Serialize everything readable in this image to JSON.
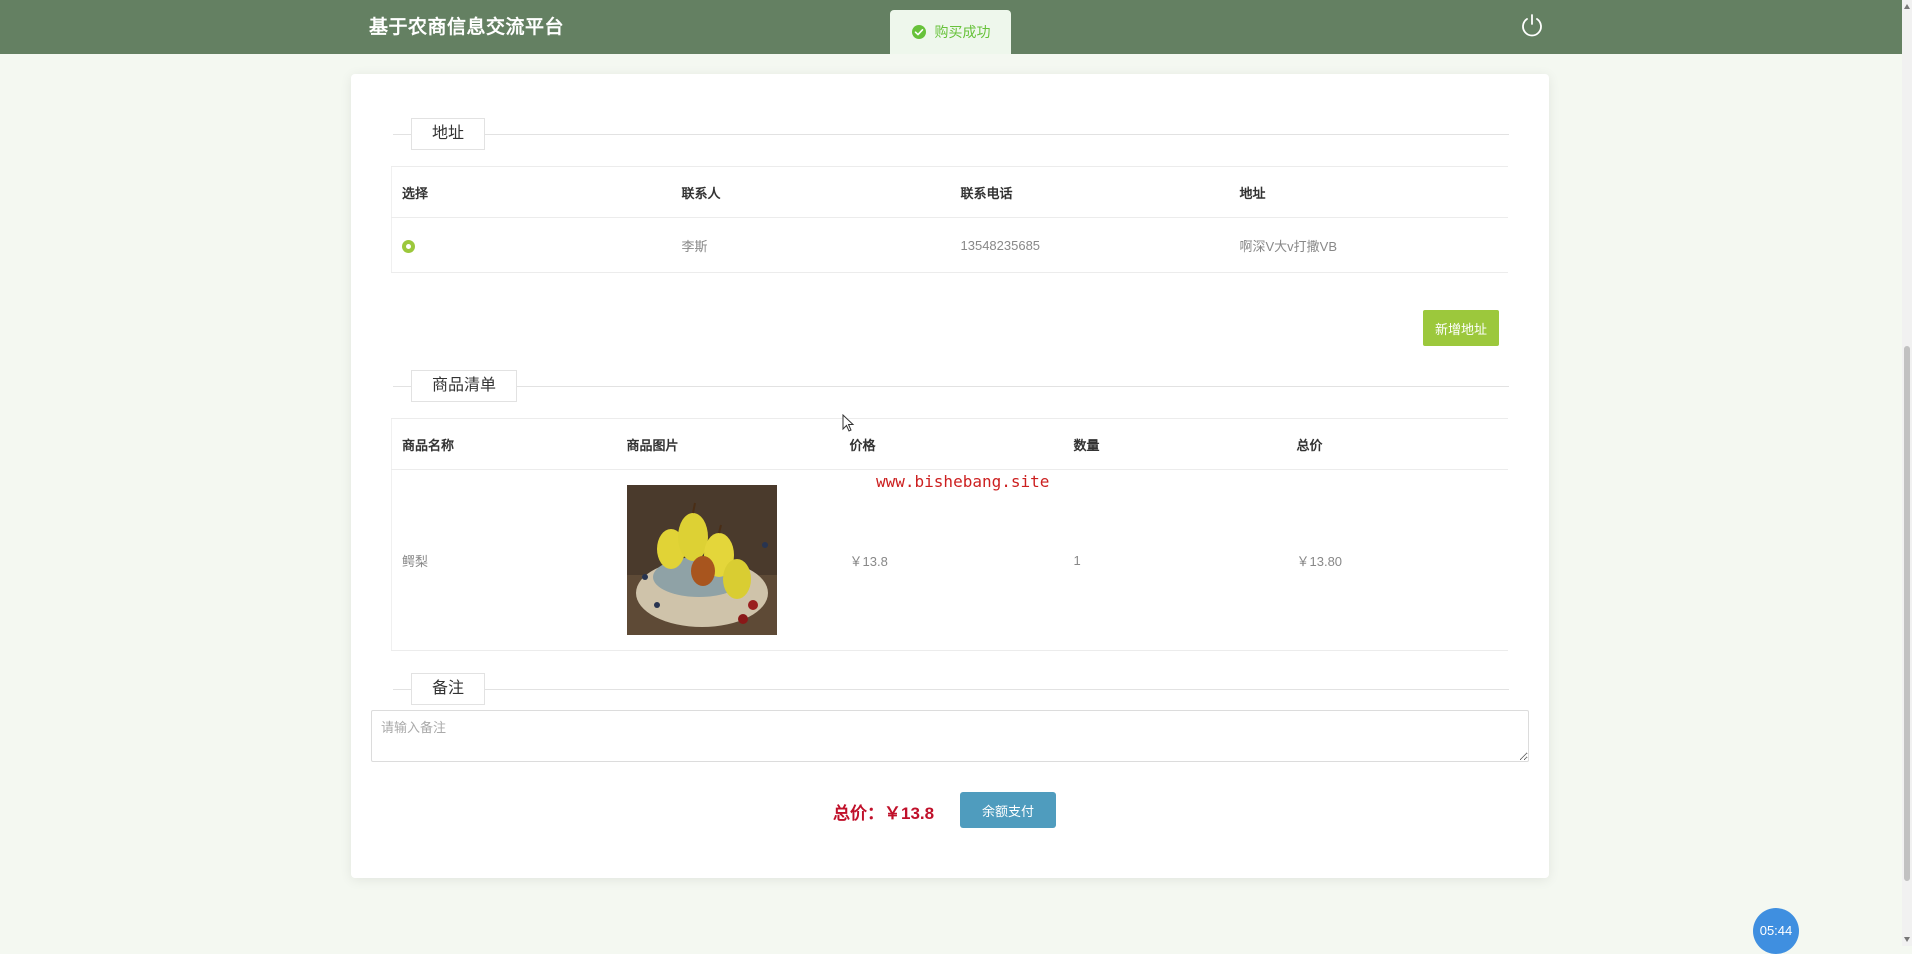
{
  "header": {
    "brand": "基于农商信息交流平台",
    "toast": "购买成功",
    "colors": {
      "bar": "#648062",
      "toast_bg": "#eef7ec",
      "toast_text": "#67c23a"
    },
    "icons": {
      "logout": "power-icon",
      "toast": "check-circle-icon"
    }
  },
  "address_section": {
    "legend": "地址",
    "columns": [
      "选择",
      "联系人",
      "联系电话",
      "地址"
    ],
    "rows": [
      {
        "selected": true,
        "contact": "李斯",
        "phone": "13548235685",
        "address": "啊深V大v打撒VB"
      }
    ],
    "add_button": "新增地址",
    "accent": "#9cc83c"
  },
  "goods_section": {
    "legend": "商品清单",
    "columns": [
      "商品名称",
      "商品图片",
      "价格",
      "数量",
      "总价"
    ],
    "rows": [
      {
        "name": "鳄梨",
        "image": "product-photo-pears",
        "price": "￥13.8",
        "quantity": "1",
        "subtotal": "￥13.80"
      }
    ]
  },
  "remark_section": {
    "legend": "备注",
    "placeholder": "请输入备注",
    "value": ""
  },
  "checkout": {
    "total_label": "总价：￥13.8",
    "pay_button": "余额支付",
    "colors": {
      "total": "#c0102a",
      "pay_button": "#4f9cbe"
    }
  },
  "watermark": "www.bishebang.site",
  "clock": "05:44"
}
